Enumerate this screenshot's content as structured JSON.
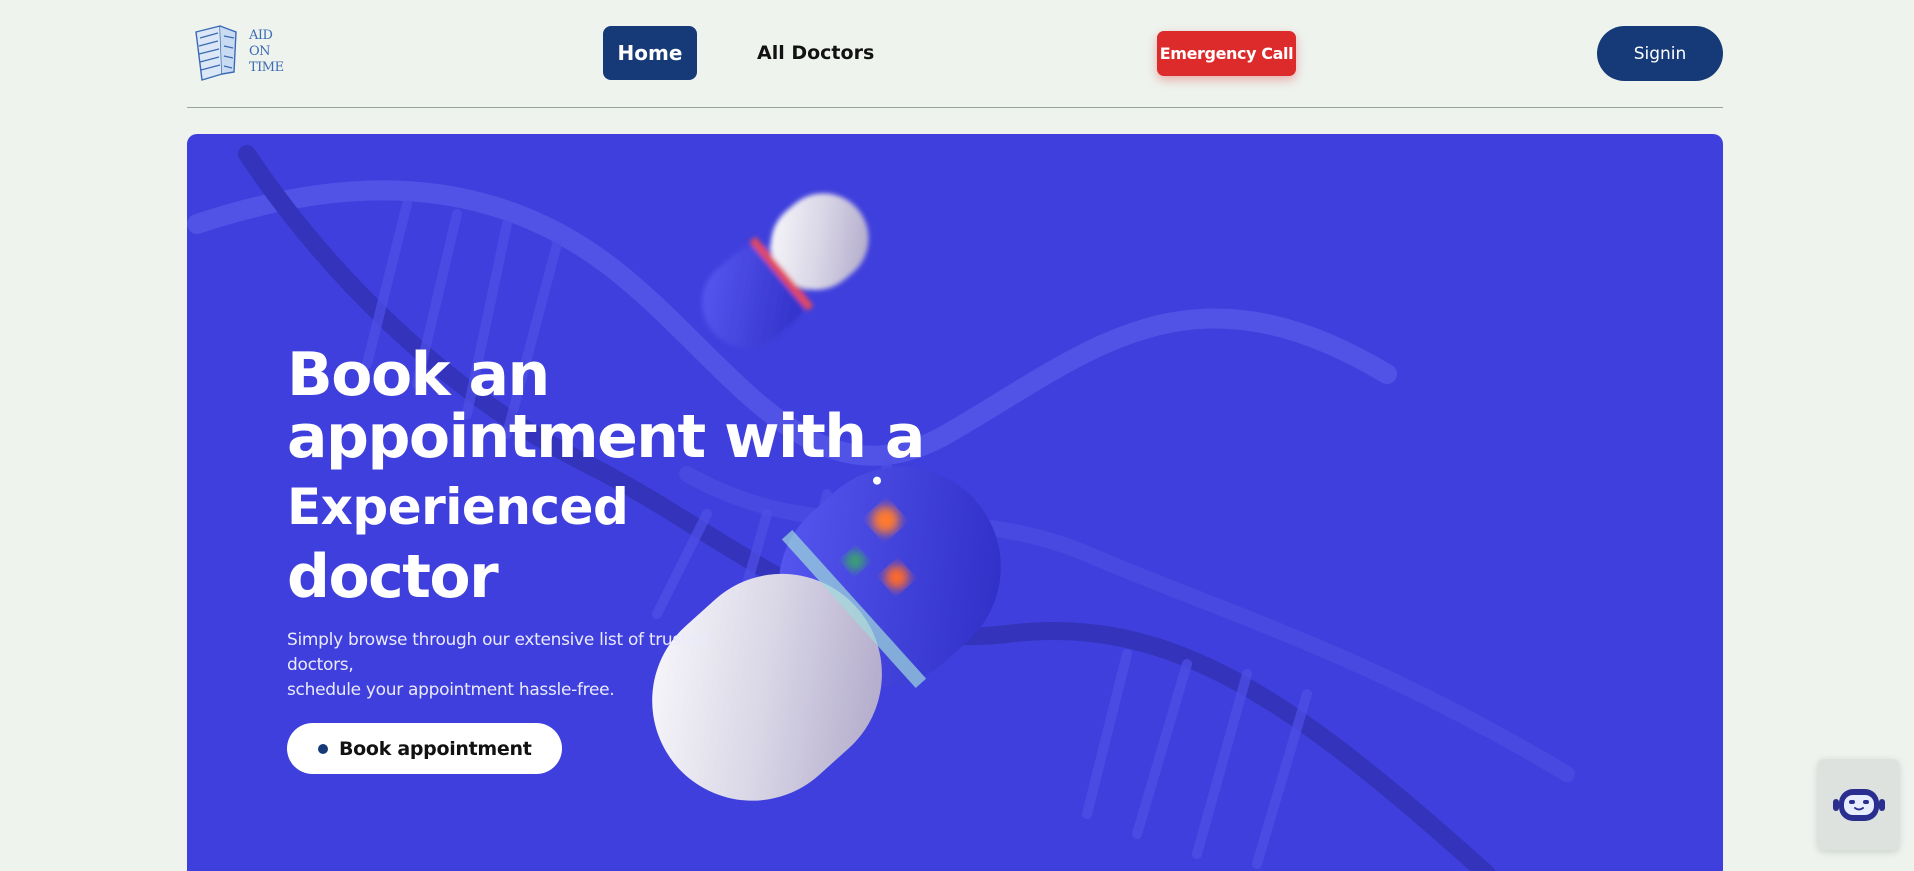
{
  "header": {
    "logo_text": [
      "AID",
      "ON",
      "TIME"
    ],
    "nav": {
      "home_label": "Home",
      "all_doctors_label": "All Doctors"
    },
    "emergency_label": "Emergency Call",
    "signin_label": "Signin"
  },
  "hero": {
    "title_lines": [
      "Book an",
      "appointment with a",
      "Experienced",
      "doctor"
    ],
    "subtitle_lines": [
      "Simply browse through our extensive list of trusted doctors,",
      "schedule your appointment hassle-free."
    ],
    "cta_label": "Book appointment"
  },
  "colors": {
    "primary": "#163a78",
    "hero_bg": "#3f3fdd",
    "emergency": "#dd2a2a",
    "page_bg": "#eef3ee"
  },
  "icons": {
    "logo": "winged-shield-logo-icon",
    "chatbot": "robot-chat-icon",
    "cta_dot": "dot-icon"
  }
}
